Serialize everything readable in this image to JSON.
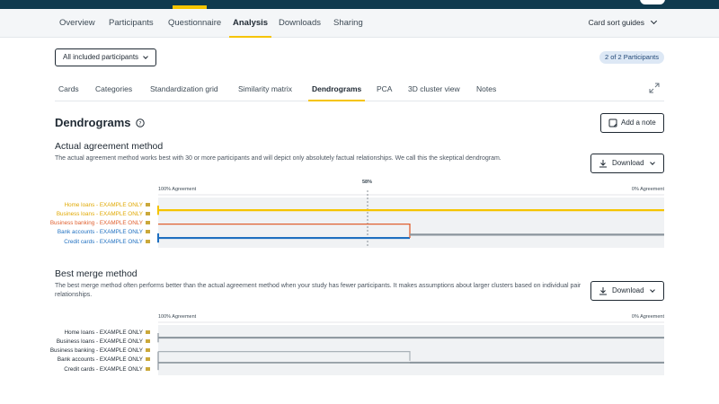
{
  "main_nav": {
    "items": [
      "Overview",
      "Participants",
      "Questionnaire",
      "Analysis",
      "Downloads",
      "Sharing"
    ],
    "active": "Analysis",
    "guides_label": "Card sort guides"
  },
  "filter": {
    "value": "All included participants"
  },
  "participants_badge": "2 of 2 Participants",
  "sub_nav": {
    "items": [
      "Cards",
      "Categories",
      "Standardization grid",
      "Similarity matrix",
      "Dendrograms",
      "PCA",
      "3D cluster view",
      "Notes"
    ],
    "active": "Dendrograms"
  },
  "page": {
    "title": "Dendrograms",
    "add_note_label": "Add a note",
    "download_label": "Download"
  },
  "sections": [
    {
      "title": "Actual agreement method",
      "description": "The actual agreement method works best with 30 or more participants and will depict only absolutely factual relationships. We call this the skeptical dendrogram.",
      "axis_left": "100% Agreement",
      "axis_right": "0% Agreement",
      "marker_label": "58%",
      "leaves": [
        "Home loans - EXAMPLE ONLY",
        "Business loans - EXAMPLE ONLY",
        "Business banking - EXAMPLE ONLY",
        "Bank accounts - EXAMPLE ONLY",
        "Credit cards - EXAMPLE ONLY"
      ],
      "leaf_colors": [
        "#e0a800",
        "#e0a800",
        "#e06030",
        "#1e6fc0",
        "#1e6fc0"
      ]
    },
    {
      "title": "Best merge method",
      "description": "The best merge method often performs better than the actual agreement method when your study has fewer participants. It makes assumptions about larger clusters based on individual pair relationships.",
      "axis_left": "100% Agreement",
      "axis_right": "0% Agreement",
      "leaves": [
        "Home loans - EXAMPLE ONLY",
        "Business loans - EXAMPLE ONLY",
        "Business banking - EXAMPLE ONLY",
        "Bank accounts - EXAMPLE ONLY",
        "Credit cards - EXAMPLE ONLY"
      ],
      "leaf_colors": [
        "#1f2933",
        "#1f2933",
        "#1f2933",
        "#1f2933",
        "#1f2933"
      ]
    }
  ],
  "colors": {
    "accent": "#f5c400",
    "header": "#0f3a4e",
    "cluster_yellow": "#f5c400",
    "cluster_orange": "#e06030",
    "cluster_blue": "#1e6fc0",
    "merge_gray": "#8a949c"
  },
  "icons": [
    "help-circle-icon",
    "note-icon",
    "download-icon",
    "chevron-down-icon",
    "expand-icon"
  ]
}
